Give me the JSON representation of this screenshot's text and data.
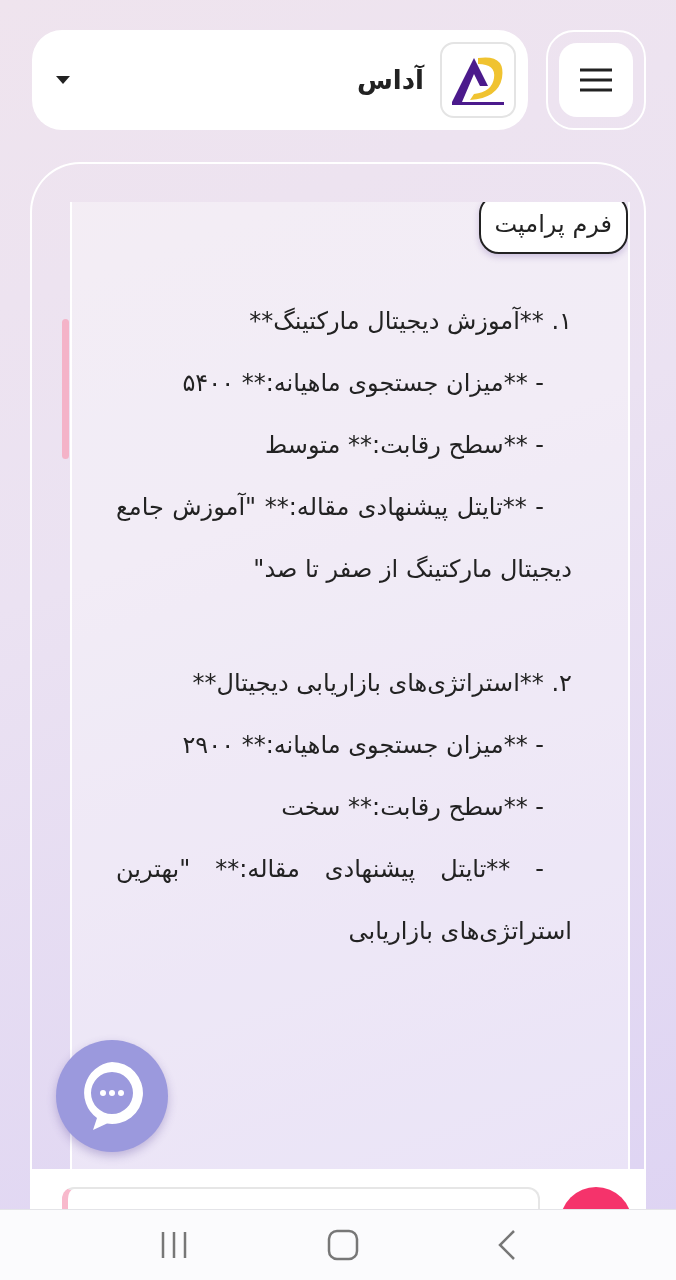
{
  "header": {
    "brand": "آداس"
  },
  "prompt_badge": "فرم پرامپت",
  "paragraphs": [
    {
      "kind": "heading",
      "text": "۱. **آموزش دیجیتال مارکتینگ**"
    },
    {
      "kind": "sub",
      "text": "- **میزان جستجوی ماهیانه:** ۵۴۰۰"
    },
    {
      "kind": "sub",
      "text": "- **سطح رقابت:** متوسط"
    },
    {
      "kind": "sub",
      "text": "- **تایتل پیشنهادی مقاله:** \"آموزش جامع دیجیتال مارکتینگ از صفر تا صد\""
    },
    {
      "kind": "heading",
      "text": "۲. **استراتژی‌های بازاریابی دیجیتال**"
    },
    {
      "kind": "sub",
      "text": "- **میزان جستجوی ماهیانه:** ۲۹۰۰"
    },
    {
      "kind": "sub",
      "text": "- **سطح رقابت:** سخت"
    },
    {
      "kind": "sub",
      "text": "- **تایتل پیشنهادی مقاله:** \"بهترین استراتژی‌های بازاریابی"
    }
  ]
}
